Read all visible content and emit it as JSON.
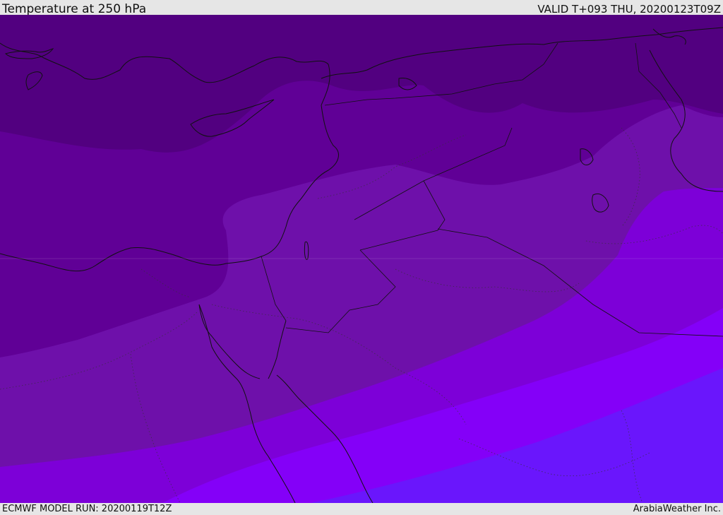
{
  "header": {
    "title": "Temperature at 250 hPa",
    "valid_time": "VALID T+093 THU, 20200123T09Z"
  },
  "footer": {
    "model_run": "ECMWF MODEL RUN: 20200119T12Z",
    "credit": "ArabiaWeather Inc."
  },
  "map": {
    "field": "temperature-250hPa",
    "band_colors": [
      "#520080",
      "#600096",
      "#6e10aa",
      "#7d00d8",
      "#8400f8",
      "#6a16fc"
    ],
    "line_color": "#111111"
  }
}
